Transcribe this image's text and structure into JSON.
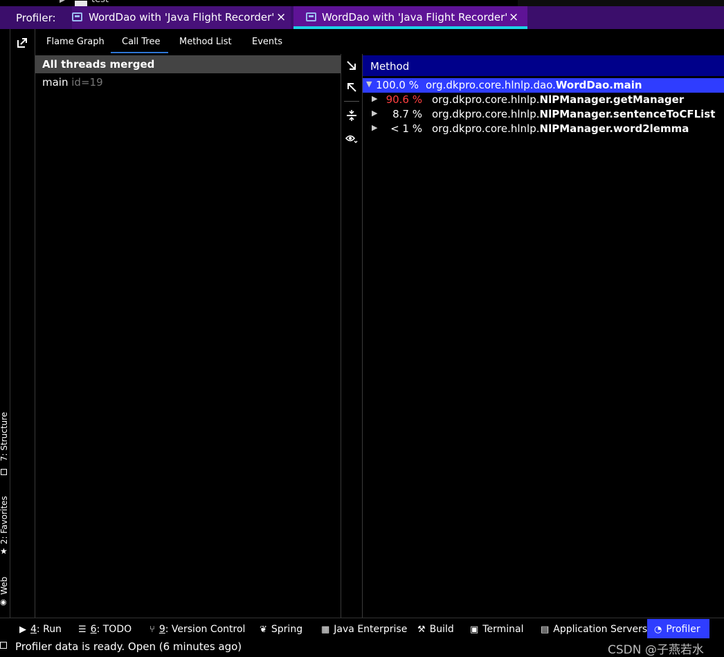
{
  "top_strip": {
    "tree_item": "test"
  },
  "tabbar": {
    "prefix": "Profiler:",
    "tabs": [
      {
        "label": "WordDao with 'Java Flight Recorder'",
        "close": "×"
      },
      {
        "label": "WordDao with 'Java Flight Recorder'",
        "close": "×"
      }
    ]
  },
  "left_strip": {
    "items": [
      "7: Structure",
      "2: Favorites",
      "Web"
    ]
  },
  "subtabs": [
    "Flame Graph",
    "Call Tree",
    "Method List",
    "Events"
  ],
  "threads": {
    "header": "All threads merged",
    "rows": [
      {
        "name": "main",
        "id": "id=19"
      }
    ]
  },
  "method_panel": {
    "header": "Method",
    "rows": [
      {
        "percent": "100.0 %",
        "prefix": "org.dkpro.core.hlnlp.dao.",
        "method": "WordDao.main",
        "expanded": true
      },
      {
        "percent": "90.6 %",
        "prefix": "org.dkpro.core.hlnlp.",
        "method": "NlPManager.getManager",
        "expanded": false
      },
      {
        "percent": "8.7 %",
        "prefix": "org.dkpro.core.hlnlp.",
        "method": "NlPManager.sentenceToCFList",
        "expanded": false
      },
      {
        "percent": "< 1 %",
        "prefix": "org.dkpro.core.hlnlp.",
        "method": "NlPManager.word2lemma",
        "expanded": false
      }
    ],
    "colors": {
      "selected_bg": "#2f3dff",
      "hot_percent": "#ff4040"
    }
  },
  "bottombar": {
    "items": [
      {
        "key": "4",
        "label": ": Run"
      },
      {
        "key": "6",
        "label": ": TODO"
      },
      {
        "key": "9",
        "label": ": Version Control"
      },
      {
        "key": "",
        "label": "Spring"
      },
      {
        "key": "",
        "label": "Java Enterprise"
      },
      {
        "key": "",
        "label": "Build"
      },
      {
        "key": "",
        "label": "Terminal"
      },
      {
        "key": "",
        "label": "Application Servers"
      },
      {
        "key": "",
        "label": "Profiler"
      }
    ]
  },
  "statusbar": {
    "text": "Profiler data is ready. Open (6 minutes ago)",
    "watermark": "CSDN @子燕若水"
  }
}
